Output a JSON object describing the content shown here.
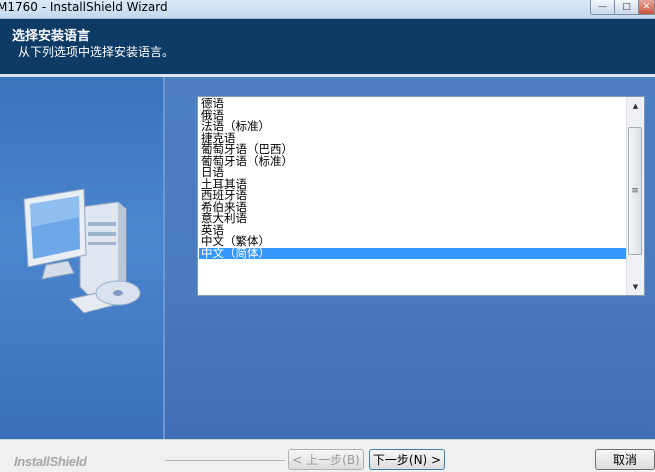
{
  "window": {
    "title": "M1760 - InstallShield Wizard",
    "min_glyph": "—",
    "max_glyph": "□",
    "close_glyph": "✕"
  },
  "header": {
    "title": "选择安装语言",
    "subtitle": "从下列选项中选择安装语言。"
  },
  "languages": {
    "items": [
      "德语",
      "俄语",
      "法语（标准）",
      "捷克语",
      "葡萄牙语（巴西）",
      "葡萄牙语（标准）",
      "日语",
      "土耳其语",
      "西班牙语",
      "希伯来语",
      "意大利语",
      "英语",
      "中文（繁体）",
      "中文（简体）"
    ],
    "selected": "中文（简体）"
  },
  "scrollbar": {
    "up_glyph": "▲",
    "down_glyph": "▼",
    "grip_glyph": "≡"
  },
  "footer": {
    "brand": "InstallShield",
    "back_label": "< 上一步(B)",
    "next_label": "下一步(N) >",
    "cancel_label": "取消"
  },
  "colors": {
    "header_bg": "#0e3a66",
    "panel_blue": "#4a7bbf",
    "selection": "#3399ff"
  }
}
